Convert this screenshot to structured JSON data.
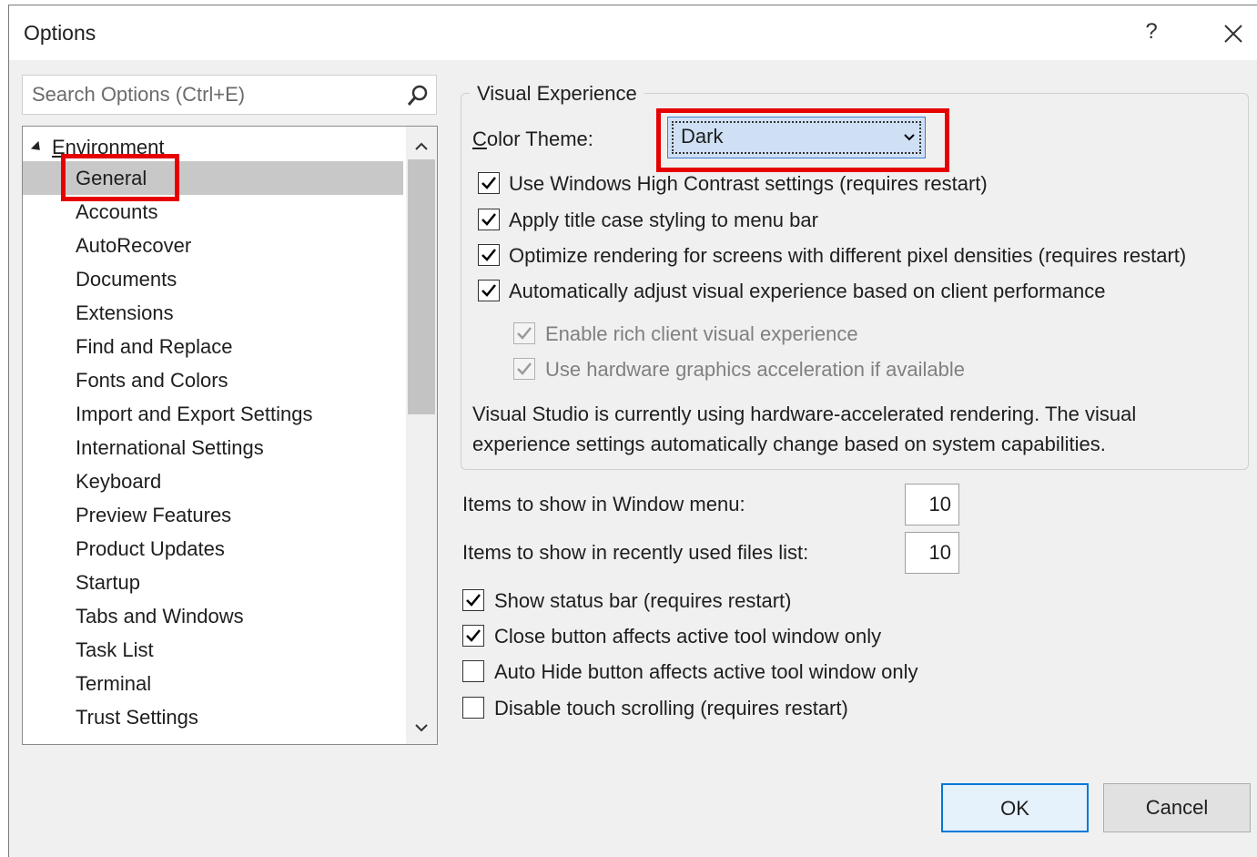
{
  "window": {
    "title": "Options",
    "help": "?"
  },
  "search": {
    "placeholder": "Search Options (Ctrl+E)"
  },
  "tree": {
    "root": "Environment",
    "items": [
      {
        "label": "General",
        "selected": true
      },
      {
        "label": "Accounts"
      },
      {
        "label": "AutoRecover"
      },
      {
        "label": "Documents"
      },
      {
        "label": "Extensions"
      },
      {
        "label": "Find and Replace"
      },
      {
        "label": "Fonts and Colors"
      },
      {
        "label": "Import and Export Settings"
      },
      {
        "label": "International Settings"
      },
      {
        "label": "Keyboard"
      },
      {
        "label": "Preview Features"
      },
      {
        "label": "Product Updates"
      },
      {
        "label": "Startup"
      },
      {
        "label": "Tabs and Windows"
      },
      {
        "label": "Task List"
      },
      {
        "label": "Terminal"
      },
      {
        "label": "Trust Settings"
      }
    ]
  },
  "visual": {
    "group_title": "Visual Experience",
    "color_theme_label": "Color Theme:",
    "color_theme_value": "Dark",
    "checks": [
      {
        "label": "Use Windows High Contrast settings (requires restart)",
        "checked": true
      },
      {
        "label": "Apply title case styling to menu bar",
        "checked": true
      },
      {
        "label": "Optimize rendering for screens with different pixel densities (requires restart)",
        "checked": true
      },
      {
        "label": "Automatically adjust visual experience based on client performance",
        "checked": true
      },
      {
        "label": "Enable rich client visual experience",
        "checked": true,
        "disabled": true
      },
      {
        "label": "Use hardware graphics acceleration if available",
        "checked": true,
        "disabled": true
      }
    ],
    "info_line1": "Visual Studio is currently using hardware-accelerated rendering. The visual",
    "info_line2": "experience settings automatically change based on system capabilities."
  },
  "window_menu": {
    "label": "Items to show in Window menu:",
    "value": "10"
  },
  "recent_files": {
    "label": "Items to show in recently used files list:",
    "value": "10"
  },
  "bottom_checks": [
    {
      "label": "Show status bar (requires restart)",
      "checked": true
    },
    {
      "label": "Close button affects active tool window only",
      "checked": true
    },
    {
      "label": "Auto Hide button affects active tool window only",
      "checked": false
    },
    {
      "label": "Disable touch scrolling (requires restart)",
      "checked": false
    }
  ],
  "buttons": {
    "ok": "OK",
    "cancel": "Cancel"
  },
  "colors": {
    "highlight": "#e60000",
    "accent": "#0078d7"
  }
}
